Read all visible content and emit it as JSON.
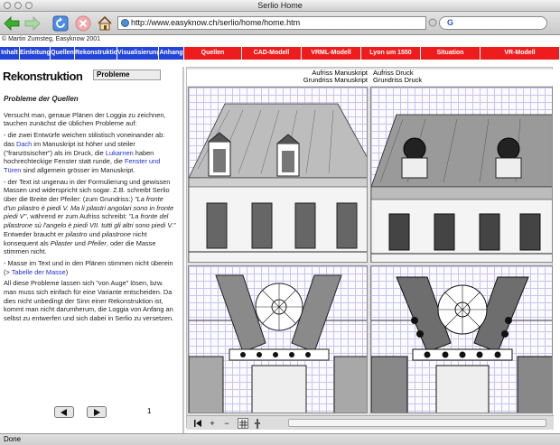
{
  "window": {
    "title": "Serlio Home"
  },
  "browser": {
    "url": "http://www.easyknow.ch/serlio/home/home.htm",
    "search_placeholder": "G",
    "status": "Done"
  },
  "page": {
    "copyright": "© Martin Zumsteg, Easyknow 2001",
    "nav_blue": [
      "Inhalt",
      "Einleitung",
      "Quellen",
      "Rekonstruktion",
      "Visualisierung",
      "Anhang"
    ],
    "nav_red": [
      "Quellen",
      "CAD-Modell",
      "VRML-Modell",
      "Lyon um 1550",
      "Situation",
      "VR-Modell"
    ],
    "heading": "Rekonstruktion",
    "subtab": "Probleme",
    "section_title": "Probleme der Quellen",
    "paragraphs": {
      "p1": "Versucht man, genaue Plänen der Loggia zu zeichnen, tauchen zunächst die üblichen Probleme auf:",
      "p2a": "- die zwei Entwürfe weichen stilistisch voneinander ab: das ",
      "p2_link1": "Dach",
      "p2b": " im Manuskript ist höher und steiler (\"französischer\") als im Druck, die ",
      "p2_link2": "Lukarnen",
      "p2c": " haben hochrechteckige Fenster statt runde, die ",
      "p2_link3": "Fenster und Türen",
      "p2d": " sind allgemein grösser im Manuskript.",
      "p3a": "- der Text ist ungenau in der Formulierung und gewissen Massen und widerspricht sich sogar. Z.B. schreibt Serlio über die Breite der Pfeiler: (zum Grundriss:) ",
      "p3_it1": "\"La fronte d'un pilastro è piedi V. Ma li pilastri angolari sono in fronte piedi V\"",
      "p3b": ", während er zum Aufriss schreibt: ",
      "p3_it2": "\"La fronte del pilastrone sù l'angelo è piedi VII. tutti gli altri sono piedi V.\"",
      "p3c": " Entweder braucht er ",
      "p3_it3": "pilastro",
      "p3d": " und ",
      "p3_it4": "pilastrone",
      "p3e": " nicht konsequent als ",
      "p3_it5": "Pilaster",
      "p3f": " und ",
      "p3_it6": "Pfeiler",
      "p3g": ", oder die Masse stimmen nicht.",
      "p4a": "- Masse im Text und in den Plänen stimmen nicht überein (> ",
      "p4_link": "Tabelle der Masse",
      "p4b": ")",
      "p5": "All diese Probleme lassen sich \"von Auge\" lösen, bzw. man muss sich einfach für eine Variante entscheiden. Da dies nicht unbedingt der Sinn einer Rekonstruktion ist, kommt man nicht darumherum, die Loggia von Anfang an selbst zu entwerfen und sich dabei in Serlio zu versetzen."
    },
    "page_number": "1",
    "viewer": {
      "label_left_top": "Aufriss Manuskript",
      "label_left_bottom": "Grundriss Manuskript",
      "label_right_top": "Aufriss Druck",
      "label_right_bottom": "Grundriss Druck"
    },
    "colors": {
      "nav_blue": "#2344d8",
      "nav_red": "#ee1c1c",
      "link": "#1a2fd8"
    }
  }
}
